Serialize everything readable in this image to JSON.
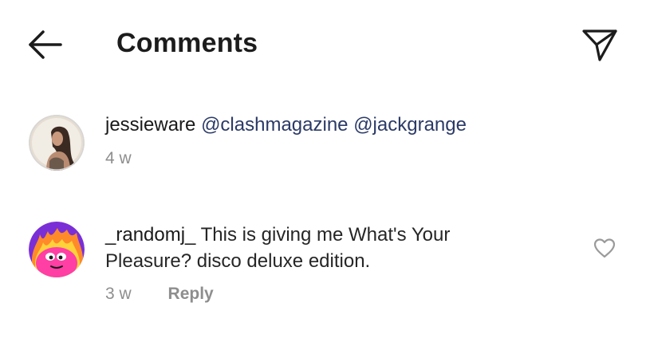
{
  "header": {
    "title": "Comments",
    "back_icon": "arrow-left-icon",
    "send_icon": "paper-plane-icon"
  },
  "comments": [
    {
      "username": "jessieware",
      "mentions": [
        "@clashmagazine",
        "@jackgrange"
      ],
      "time": "4 w"
    },
    {
      "username": "_randomj_",
      "text_line1": "This is giving me What's Your",
      "text_line2": "Pleasure? disco deluxe edition.",
      "time": "3 w",
      "reply_label": "Reply",
      "like_icon": "heart-outline-icon"
    }
  ],
  "colors": {
    "text": "#262626",
    "mention": "#2b3a67",
    "meta": "#8e8e8e"
  }
}
